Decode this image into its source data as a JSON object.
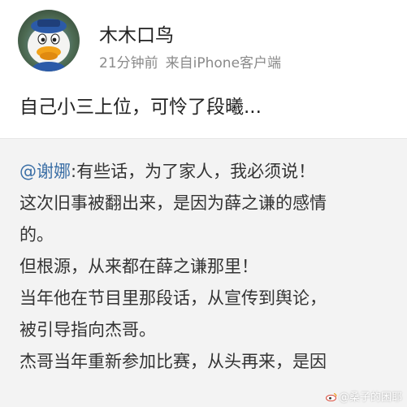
{
  "post": {
    "username": "木木口鸟",
    "time": "21分钟前",
    "source_prefix": "来自",
    "source_device": "iPhone客户端",
    "text": "自己小三上位，可怜了段曦..."
  },
  "repost": {
    "mention": "@谢娜",
    "first_line_rest": ":有些话，为了家人，我必须说！",
    "lines": [
      "这次旧事被翻出来，是因为薛之谦的感情",
      "的。",
      "但根源，从来都在薛之谦那里！",
      "当年他在节目里那段话，从宣传到舆论，",
      "被引导指向杰哥。",
      "杰哥当年重新参加比赛，从头再来，是因"
    ]
  },
  "watermark": {
    "text": "@桑子的困耶"
  },
  "colors": {
    "mention": "#3b6fa6",
    "meta": "#8a8a8a",
    "repost_background": "#f3f3f3"
  }
}
